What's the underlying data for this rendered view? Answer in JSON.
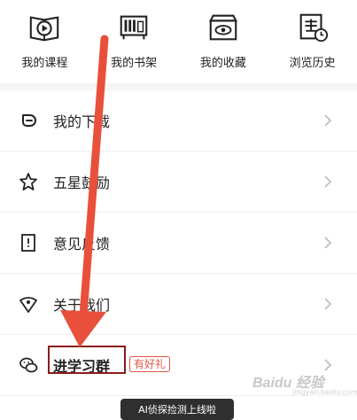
{
  "quick_actions": [
    {
      "label": "我的课程",
      "icon": "course-video-icon"
    },
    {
      "label": "我的书架",
      "icon": "bookshelf-icon"
    },
    {
      "label": "我的收藏",
      "icon": "favorites-box-icon"
    },
    {
      "label": "浏览历史",
      "icon": "history-clock-icon"
    }
  ],
  "menu": [
    {
      "label": "我的下载",
      "icon": "download-icon"
    },
    {
      "label": "五星鼓励",
      "icon": "star-icon"
    },
    {
      "label": "意见反馈",
      "icon": "feedback-icon"
    },
    {
      "label": "关于我们",
      "icon": "about-icon"
    },
    {
      "label": "进学习群",
      "icon": "wechat-icon",
      "badge": "有好礼"
    }
  ],
  "toast": "AI侦探捡测上线啦",
  "watermark": "Baidu 经验",
  "watermark_sub": "jingyan.baidu.com",
  "colors": {
    "annotation_arrow": "#e8503c",
    "highlight_box": "#8a1c1c",
    "badge": "#e05545"
  }
}
